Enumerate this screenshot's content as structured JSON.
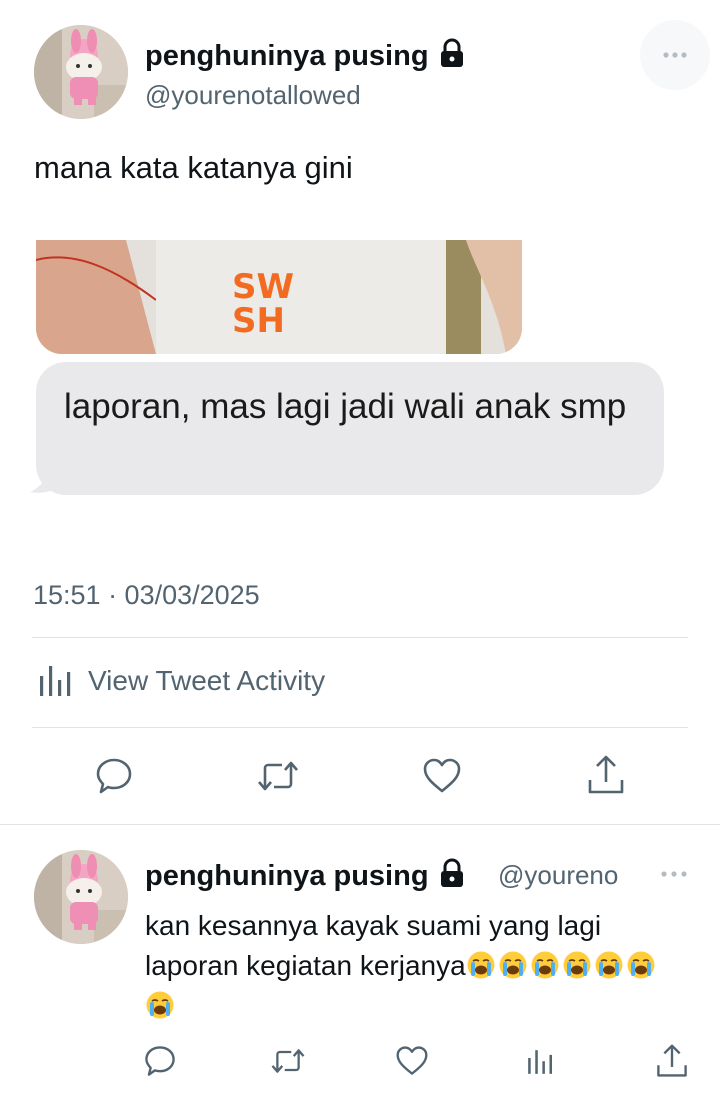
{
  "tweet": {
    "display_name": "penghuninya pusing",
    "handle": "@yourenotallowed",
    "text": "mana kata katanya gini",
    "bubble_text": "laporan, mas lagi jadi wali anak smp",
    "photo_logo_line1": "SW",
    "photo_logo_line2": "SH",
    "timestamp": "15:51 · 03/03/2025",
    "activity_label": "View Tweet Activity",
    "more_icon": "more-horizontal-icon",
    "actions": [
      "reply-icon",
      "retweet-icon",
      "like-icon",
      "share-icon"
    ]
  },
  "reply": {
    "display_name": "penghuninya pusing",
    "handle": "@youreno",
    "text": "kan kesannya kayak suami yang lagi laporan kegiatan kerjanya",
    "emoji_icon": "loudly-crying-face-emoji",
    "emoji_count": 7,
    "actions": [
      "reply-icon",
      "retweet-icon",
      "like-icon",
      "analytics-icon",
      "share-icon"
    ]
  },
  "colors": {
    "text_primary": "#0f1419",
    "text_secondary": "#536471",
    "divider": "#dfe3e6",
    "bubble": "#e9e9eb",
    "logo_orange": "#f26b21"
  }
}
